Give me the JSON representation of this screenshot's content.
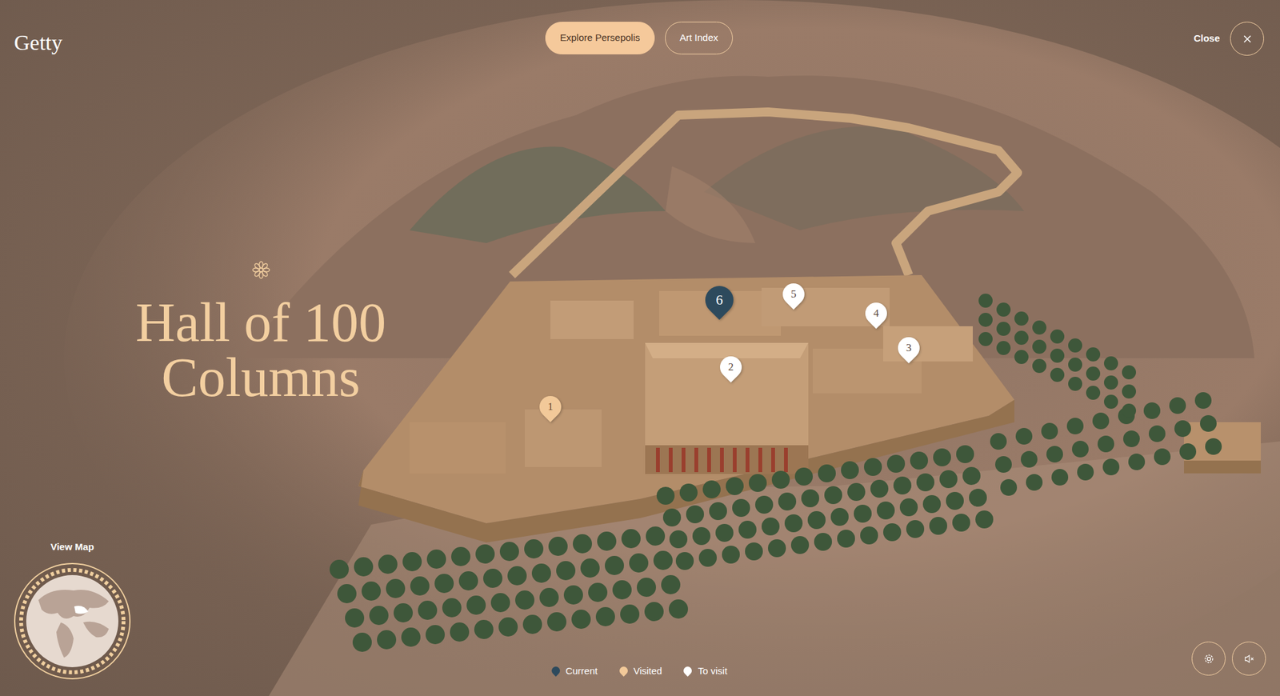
{
  "logo": "Getty",
  "tabs": [
    {
      "label": "Explore Persepolis",
      "selected": true
    },
    {
      "label": "Art Index",
      "selected": false
    }
  ],
  "close": {
    "label": "Close"
  },
  "title": "Hall of 100 Columns",
  "map": {
    "label": "View Map"
  },
  "pins": [
    {
      "number": "1",
      "status": "visited"
    },
    {
      "number": "2",
      "status": "to-visit"
    },
    {
      "number": "3",
      "status": "to-visit"
    },
    {
      "number": "4",
      "status": "to-visit"
    },
    {
      "number": "5",
      "status": "to-visit"
    },
    {
      "number": "6",
      "status": "current"
    }
  ],
  "legend": [
    {
      "label": "Current",
      "status": "current"
    },
    {
      "label": "Visited",
      "status": "visited"
    },
    {
      "label": "To visit",
      "status": "to-visit"
    }
  ]
}
